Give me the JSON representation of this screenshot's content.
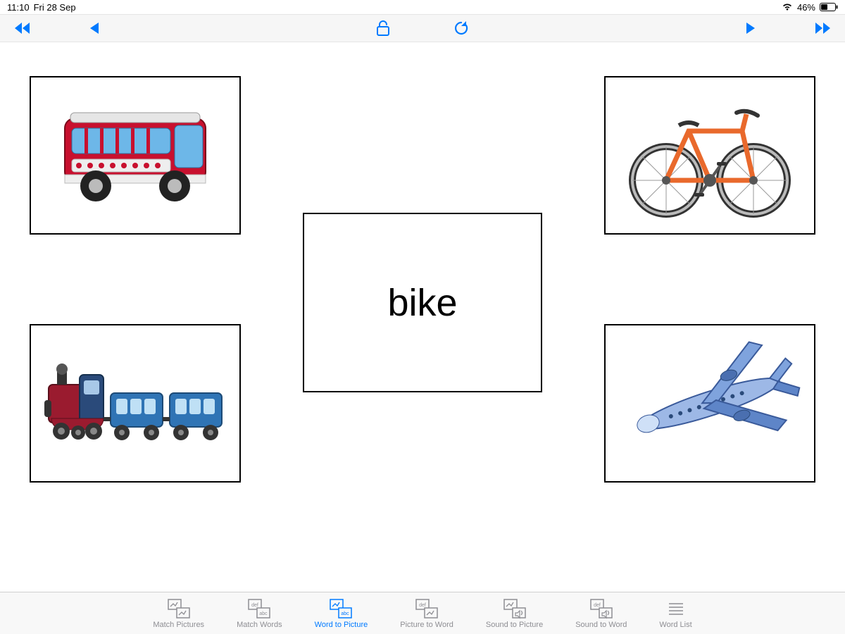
{
  "status": {
    "time": "11:10",
    "date": "Fri 28 Sep",
    "battery_pct": "46%"
  },
  "word_card": "bike",
  "options": [
    {
      "name": "bus"
    },
    {
      "name": "bike"
    },
    {
      "name": "train"
    },
    {
      "name": "plane"
    }
  ],
  "tabs": [
    {
      "label": "Match Pictures"
    },
    {
      "label": "Match Words"
    },
    {
      "label": "Word to Picture"
    },
    {
      "label": "Picture to Word"
    },
    {
      "label": "Sound to Picture"
    },
    {
      "label": "Sound to Word"
    },
    {
      "label": "Word List"
    }
  ],
  "active_tab_index": 2
}
